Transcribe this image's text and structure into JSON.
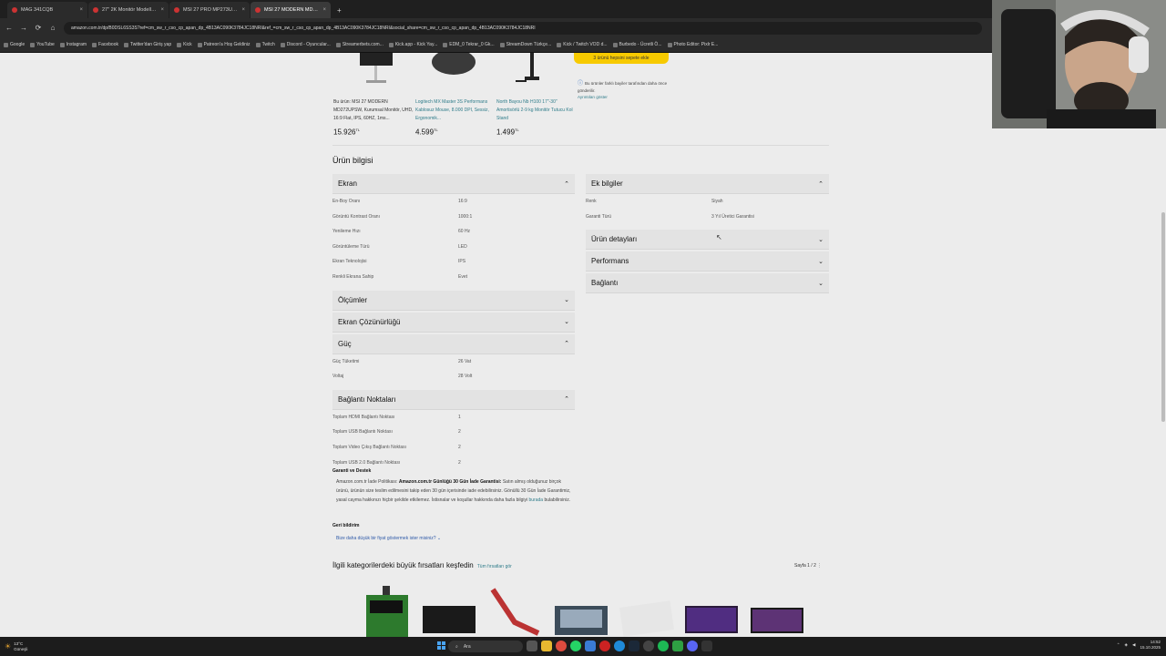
{
  "browser": {
    "tabs": [
      {
        "title": "MAG 341CQB",
        "active": false
      },
      {
        "title": "27\" 2K Monitör Modelleri B...",
        "active": false
      },
      {
        "title": "MSI 27 PRO MP273U Kurumsal...",
        "active": false
      },
      {
        "title": "MSI 27 MODERN MD272UPS...",
        "active": true
      }
    ],
    "url": "amazon.com.tr/dp/B0DSL6SS3S?ref=cm_sw_r_cso_cp_apan_dp_4B13AC090K3784JC18NRI&ref_=cm_sw_r_cso_cp_apan_dp_4B13AC090K3784JC18NRI&social_share=cm_sw_r_cso_cp_apan_dp_4B13AC090K3784JC18NRI",
    "bookmarks": [
      "Google",
      "YouTube",
      "Instagram",
      "Facebook",
      "Twitter'dan Giriş yap",
      "Kick",
      "Patreon'a Hoş Geldiniz",
      "Twitch",
      "Discord - Oyuncular...",
      "Streamerbets.com...",
      "Kick.app - Kick Yay...",
      "EDM_0 Tekrar_0 Gk...",
      "StreamDown Türkçe...",
      "Kick / Twitch VOD d...",
      "Burbedo - Ücretli Ö...",
      "Photo Editor: Pixlr E..."
    ]
  },
  "carousel": {
    "products": [
      {
        "title": "Bu ürün: MSI 27 MODERN MD272UPSW, Kurumsal Monitör, UHD, 16:9 Flat, IPS, 60HZ, 1ms...",
        "price": "15.926",
        "currency": "TL"
      },
      {
        "title": "Logitech MX Master 3S Performans Kablosuz Mouse, 8.000 DPI, Sessiz, Ergonomik...",
        "price": "4.599",
        "currency": "TL"
      },
      {
        "title": "North Bayou Nb H100 17\"-30\" Amortisörlü 2-9 kg Monitör Tutucu Kol Stand",
        "price": "1.499",
        "currency": "TL"
      }
    ],
    "cart_button": "3 ürünü hepsini sepete ekle",
    "note": "Bu ürünler farklı bayiler tarafından daha önce gönderilir.",
    "note_link": "Ayrıntıları göster"
  },
  "product_info": {
    "title": "Ürün bilgisi",
    "left": [
      {
        "name": "Ekran",
        "expanded": true,
        "rows": [
          {
            "k": "En-Boy Oranı",
            "v": "16:9"
          },
          {
            "k": "Görüntü Kontrast Oranı",
            "v": "1000:1"
          },
          {
            "k": "Yenileme Hızı",
            "v": "60 Hz"
          },
          {
            "k": "Görüntüleme Türü",
            "v": "LED"
          },
          {
            "k": "Ekran Teknolojisi",
            "v": "IPS"
          },
          {
            "k": "Renkli Ekrana Sahip",
            "v": "Evet"
          }
        ]
      },
      {
        "name": "Ölçümler",
        "expanded": false,
        "rows": []
      },
      {
        "name": "Ekran Çözünürlüğü",
        "expanded": false,
        "rows": []
      },
      {
        "name": "Güç",
        "expanded": true,
        "rows": [
          {
            "k": "Güç Tüketimi",
            "v": "26 Vat"
          },
          {
            "k": "Voltaj",
            "v": "28 Volt"
          }
        ]
      },
      {
        "name": "Bağlantı Noktaları",
        "expanded": true,
        "rows": [
          {
            "k": "Toplam HDMI Bağlantı Noktası",
            "v": "1"
          },
          {
            "k": "Toplam USB Bağlantı Noktası",
            "v": "2"
          },
          {
            "k": "Toplam Video Çıkış Bağlantı Noktası",
            "v": "2"
          },
          {
            "k": "Toplam USB 2.0 Bağlantı Noktası",
            "v": "2"
          }
        ]
      }
    ],
    "right": [
      {
        "name": "Ek bilgiler",
        "expanded": true,
        "rows": [
          {
            "k": "Renk",
            "v": "Siyah"
          },
          {
            "k": "Garanti Türü",
            "v": "3 Yıl Üretici Garantisi"
          }
        ]
      },
      {
        "name": "Ürün detayları",
        "expanded": false,
        "rows": []
      },
      {
        "name": "Performans",
        "expanded": false,
        "rows": []
      },
      {
        "name": "Bağlantı",
        "expanded": false,
        "rows": []
      }
    ]
  },
  "warranty": {
    "heading": "Garanti ve Destek",
    "prefix": "Amazon.com.tr İade Politikası: ",
    "bold": "Amazon.com.tr Günlüğü 30 Gün İade Garantisi:",
    "body": " Satın almış olduğunuz birçok ürünü, ürünün size teslim edilmesini takip eden 30 gün içerisinde iade edebilirsiniz. Gönüllü 30 Gün İade Garantimiz, yasal cayma hakkınızı hiçbir şekilde etkilemez. İstisnalar ve koşullar hakkında daha fazla bilgiyi ",
    "link": "burada",
    "suffix": " bulabilirsiniz."
  },
  "feedback": {
    "heading": "Geri bildirim",
    "link": "Bize daha düşük bir fiyat göstermek ister misiniz?"
  },
  "deals": {
    "title": "İlgili kategorilerdeki büyük fırsatları keşfedin",
    "all_link": "Tüm fırsatları gör",
    "pager": "Sayfa 1 / 2"
  },
  "taskbar": {
    "weather_temp": "13°C",
    "weather_desc": "Güneşli",
    "search_placeholder": "Ara",
    "time": "14:52",
    "date": "15.10.2025"
  }
}
